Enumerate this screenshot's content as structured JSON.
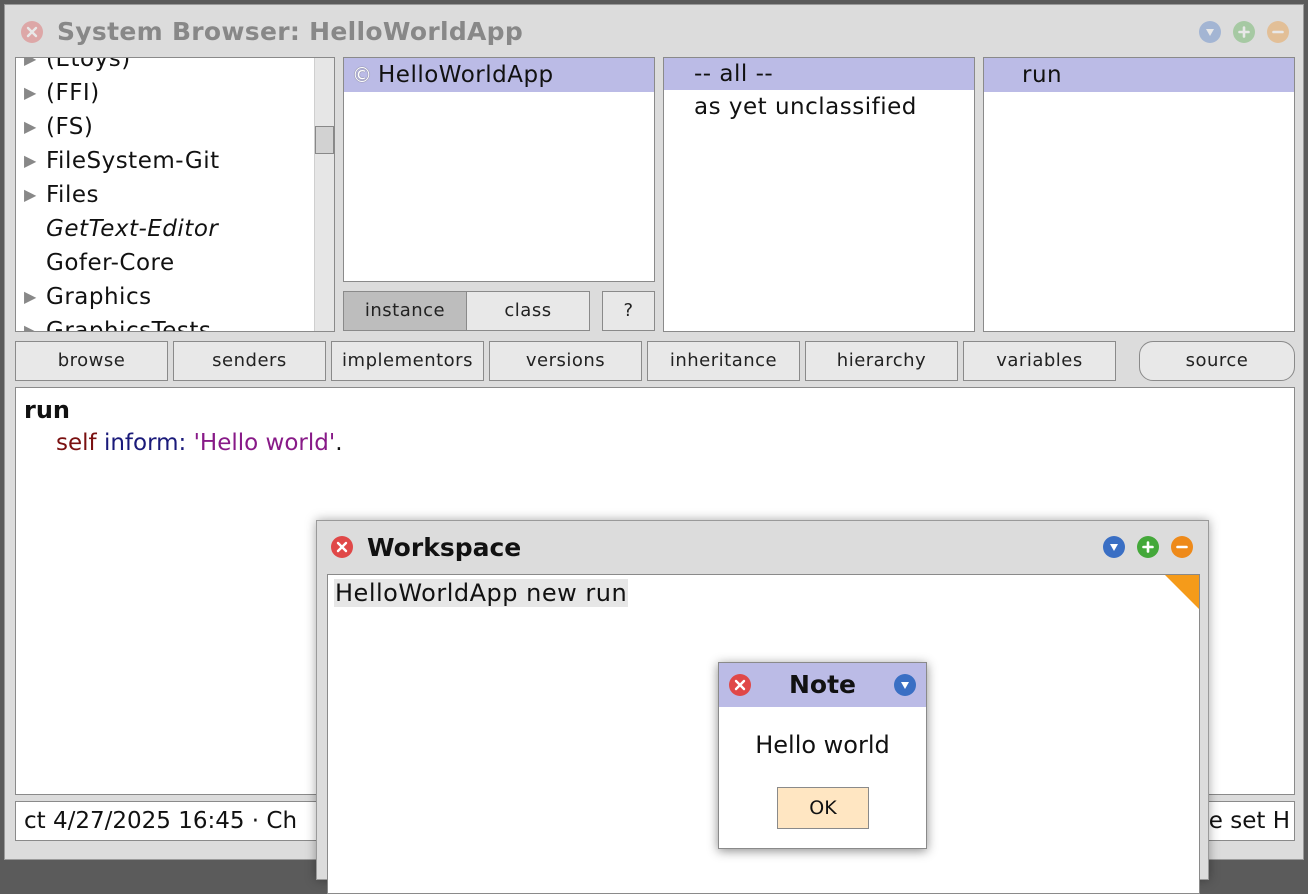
{
  "browser": {
    "title": "System Browser: HelloWorldApp",
    "packages": [
      {
        "label": "(Etoys)",
        "expandable": true,
        "italic": false
      },
      {
        "label": "(FFI)",
        "expandable": true,
        "italic": false
      },
      {
        "label": "(FS)",
        "expandable": true,
        "italic": false
      },
      {
        "label": "FileSystem-Git",
        "expandable": true,
        "italic": false
      },
      {
        "label": "Files",
        "expandable": true,
        "italic": false
      },
      {
        "label": "GetText-Editor",
        "expandable": false,
        "italic": true
      },
      {
        "label": "Gofer-Core",
        "expandable": false,
        "italic": false
      },
      {
        "label": "Graphics",
        "expandable": true,
        "italic": false
      },
      {
        "label": "GraphicsTests",
        "expandable": true,
        "italic": false
      }
    ],
    "classes": [
      {
        "label": "HelloWorldApp",
        "selected": true
      }
    ],
    "class_icon": "©",
    "protocols": [
      {
        "label": "-- all --",
        "selected": true
      },
      {
        "label": "as yet unclassified",
        "selected": false
      }
    ],
    "methods": [
      {
        "label": "run",
        "selected": true
      }
    ],
    "side_buttons": {
      "instance": "instance",
      "class": "class",
      "help": "?"
    },
    "toolbar": [
      "browse",
      "senders",
      "implementors",
      "versions",
      "inheritance",
      "hierarchy",
      "variables",
      "source"
    ],
    "code": {
      "selector": "run",
      "receiver": "self",
      "keyword": "inform:",
      "string": "'Hello world'",
      "terminator": "."
    },
    "status": {
      "left": "ct 4/27/2025 16:45 · Ch",
      "right": "e set H"
    }
  },
  "workspace": {
    "title": "Workspace",
    "text": "HelloWorldApp new run"
  },
  "note": {
    "title": "Note",
    "message": "Hello world",
    "ok_label": "OK"
  },
  "colors": {
    "selection": "#bbbbe6",
    "close": "#e04848",
    "collapse": "#3a6fc4",
    "expand": "#44a83a",
    "minimize": "#ee8a1a",
    "code_self": "#7a1010",
    "code_keyword": "#1a1a7a",
    "code_string": "#881a88",
    "ok_button": "#ffe6c2"
  }
}
